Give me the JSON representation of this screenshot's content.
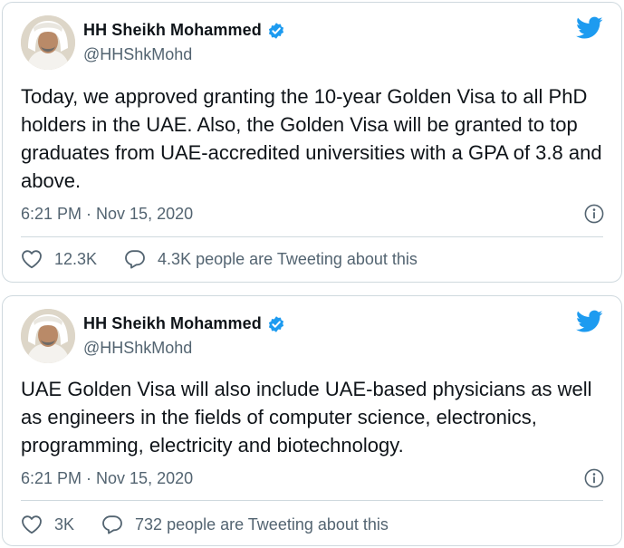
{
  "tweets": [
    {
      "author_name": "HH Sheikh Mohammed",
      "handle": "@HHShkMohd",
      "text": "Today, we approved granting the 10-year Golden Visa to all PhD holders in the UAE. Also, the Golden Visa will be granted to top graduates from UAE-accredited universities with a GPA of 3.8 and above.",
      "timestamp": "6:21 PM · Nov 15, 2020",
      "likes": "12.3K",
      "conversation": "4.3K people are Tweeting about this"
    },
    {
      "author_name": "HH Sheikh Mohammed",
      "handle": "@HHShkMohd",
      "text": "UAE Golden Visa will also include UAE-based physicians as well as engineers in the fields of computer science, electronics, programming, electricity and biotechnology.",
      "timestamp": "6:21 PM · Nov 15, 2020",
      "likes": "3K",
      "conversation": "732 people are Tweeting about this"
    }
  ],
  "colors": {
    "twitter_blue": "#1d9bf0",
    "text_primary": "#0f1419",
    "text_secondary": "#536471",
    "border": "#cfd9de"
  },
  "icons": {
    "brand": "twitter-bird-icon",
    "verified": "verified-badge-icon",
    "info": "info-icon",
    "like": "heart-icon",
    "reply": "speech-bubble-icon"
  }
}
